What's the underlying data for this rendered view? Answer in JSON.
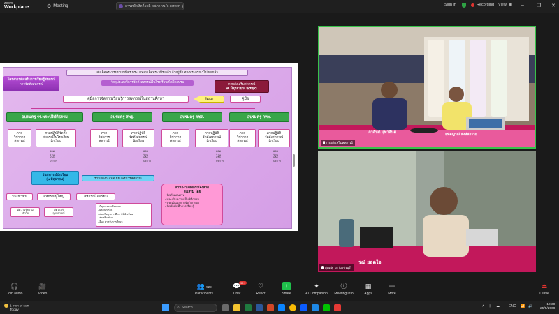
{
  "topbar": {
    "brand_line1": "zoom",
    "brand_line2": "Workplace",
    "meeting_label": "Meeting",
    "share_banner": "การหยัดหัตถ์ยาติ ดพภาคน ‘s screen",
    "sign_in": "Sign in",
    "recording": "Recording",
    "view": "View"
  },
  "slide": {
    "header1": "สมเด็จพระบรมนาถบพิตร พระบาทสมเด็จพระวชิรเกล้าเจ้าอยู่หัว ทรงพระกรุณาโปรดเกล้า",
    "header2": "วัตถุประสงค์การจัดตั้งสหกรณ์ในโรงเรียนเพื่อฝึกอบรม",
    "side_title": "โครงการส่งเสริมการเรียนรู้สหกรณ์",
    "side_sub": "การจัดตั้งสหกรณ์",
    "date_box_line1": "กรมส่งเสริมสหกรณ์",
    "date_box_line2": "๗ มิถุนายน ๒๕๖๔",
    "manual_main": "คู่มือการจัดการเรียนรู้การสหกรณ์ในสถานศึกษา",
    "arrow_label": "พัฒนา",
    "manual_right": "คู่มือ",
    "trainers": [
      "อบรมครู รร.พระปริยัติธรรม",
      "อบรมครู สพฐ.",
      "อบรมครู ตชด.",
      "อบรมครู กทพ."
    ],
    "units": [
      "ภาค\nวิชาการ\nสหกรณ์",
      "ภาคปฏิบัติจัดตั้ง\nสหกรณ์ในโรงเรียน\nนักเรียน",
      "ภาค\nวิชาการ\nสหกรณ์",
      "ภาคปฏิบัติ\nจัดตั้งสหกรณ์\nนักเรียน",
      "ภาค\nวิชาการ\nสหกรณ์",
      "ภาคปฏิบัติ\nจัดตั้งสหกรณ์\nนักเรียน",
      "ภาค\nวิชาการ\nสหกรณ์",
      "ภาคปฏิบัติ\nจัดตั้งสหกรณ์\nนักเรียน"
    ],
    "small_lists": [
      "ออม\nร้าน\nผลิต\nบริการ",
      "ออม\nร้าน\nผลิต\nบริการ",
      "ออม\nร้าน\nผลิต\nบริการ",
      "ออม\nร้าน\nผลิต\nบริการ"
    ],
    "coop_day": "วันสหกรณ์นักเรียน\n(๗ มิถุนายน)",
    "coop_day_note": "ร่วมจัดงานเพื่อเผยแพร่การสหกรณ์",
    "bottom_chain": [
      "ประชาชน",
      "สหกรณ์ผู้ใหญ่",
      "สหกรณ์นักเรียน"
    ],
    "chain_notes": [
      "มีความรู้ความ\nเข้าใจ",
      "มีความรู้\nอุดมการณ์"
    ],
    "detail_list": "- มีคุณธรรมจริยธรรม\n- ผลิตนักเรียน\n- ส่งเสริมทุนการศึกษาให้นักเรียน\n- ส่งเสริมสร้าง\n- อื่นๆ สำหรับการศึกษา",
    "province_title": "สำนักงานสหกรณ์จังหวัด\nส่งเสริม โดย",
    "province_items": "- จัดทำแผนงาน\n- ประเมินความเป็นพิธีกรรม\n- ประเมินผลการจัดกิจกรรม\n- จัดทำบันทึกการเรียนรู้"
  },
  "tiles": {
    "tile1_name": "กรมส่งเสริมสหกรณ์",
    "tile1_caption_left": "ภาสันต์ นุพาสันต์",
    "tile1_caption_right": "สุทิดญาณี สิงห์ลำราย",
    "tile2_name": "สุพณัฐ 15 (เพชรบุรี)",
    "tile2_caption": "รณ์ ยอดใจ"
  },
  "toolbar": {
    "join_audio": "Join audio",
    "video": "Video",
    "participants": "Participants",
    "participants_count": "529",
    "chat": "Chat",
    "chat_badge": "99+",
    "react": "React",
    "share": "Share",
    "ai_companion": "AI Companion",
    "meeting_info": "Meeting info",
    "apps": "Apps",
    "more": "More",
    "leave": "Leave"
  },
  "taskbar": {
    "weather_line1": "1 inch of rain",
    "weather_line2": "Today",
    "search_placeholder": "Search",
    "lang": "ENG",
    "lang2": "TH",
    "time": "10:30",
    "date": "25/5/2568"
  },
  "colors": {
    "recording": "#e0332f",
    "active_speaker": "#39c24b",
    "share_green": "#1fbf4b"
  }
}
